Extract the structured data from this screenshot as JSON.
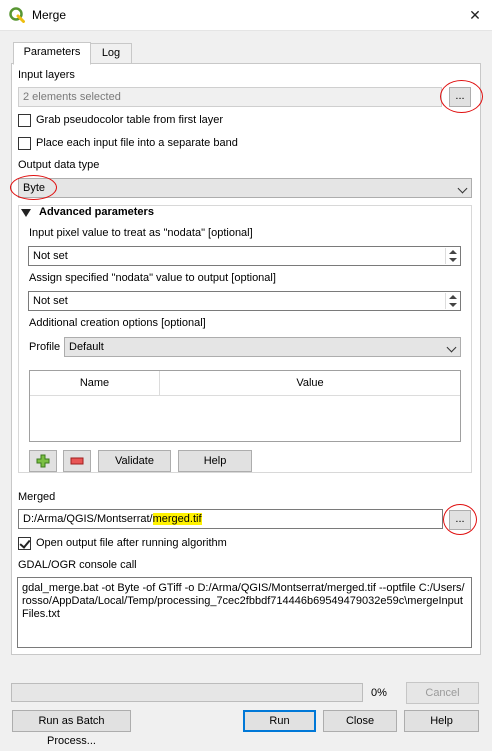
{
  "window": {
    "title": "Merge",
    "close_symbol": "✕"
  },
  "tabs": [
    {
      "label": "Parameters",
      "active": true
    },
    {
      "label": "Log",
      "active": false
    }
  ],
  "input_layers": {
    "label": "Input layers",
    "value": "2 elements selected",
    "browse_label": "..."
  },
  "checks": {
    "grab_pct": {
      "label": "Grab pseudocolor table from first layer",
      "checked": false
    },
    "separate_band": {
      "label": "Place each input file into a separate band",
      "checked": false
    }
  },
  "output_data_type": {
    "label": "Output data type",
    "value": "Byte"
  },
  "advanced": {
    "label": "Advanced parameters",
    "nodata_input_label": "Input pixel value to treat as \"nodata\" [optional]",
    "nodata_input_value": "Not set",
    "nodata_output_label": "Assign specified \"nodata\" value to output [optional]",
    "nodata_output_value": "Not set",
    "creation_label": "Additional creation options [optional]",
    "profile_label": "Profile",
    "profile_value": "Default",
    "table_headers": [
      "Name",
      "Value"
    ],
    "validate_label": "Validate",
    "help_label": "Help"
  },
  "merged": {
    "label": "Merged",
    "path_prefix": "D:/Arma/QGIS/Montserrat/",
    "path_file": "merged.tif",
    "browse_label": "...",
    "open_output": {
      "label": "Open output file after running algorithm",
      "checked": true
    }
  },
  "console": {
    "label": "GDAL/OGR console call",
    "text": "gdal_merge.bat -ot Byte -of GTiff -o D:/Arma/QGIS/Montserrat/merged.tif --optfile C:/Users/rosso/AppData/Local/Temp/processing_7cec2fbbdf714446b69549479032e59c\\mergeInputFiles.txt"
  },
  "progress": {
    "value": 0,
    "text": "0%"
  },
  "buttons": {
    "cancel": "Cancel",
    "batch": "Run as Batch Process...",
    "run": "Run",
    "close": "Close",
    "help": "Help"
  },
  "colors": {
    "annotation_red": "#e01010",
    "highlight": "#fff200",
    "accent": "#0078d7"
  }
}
